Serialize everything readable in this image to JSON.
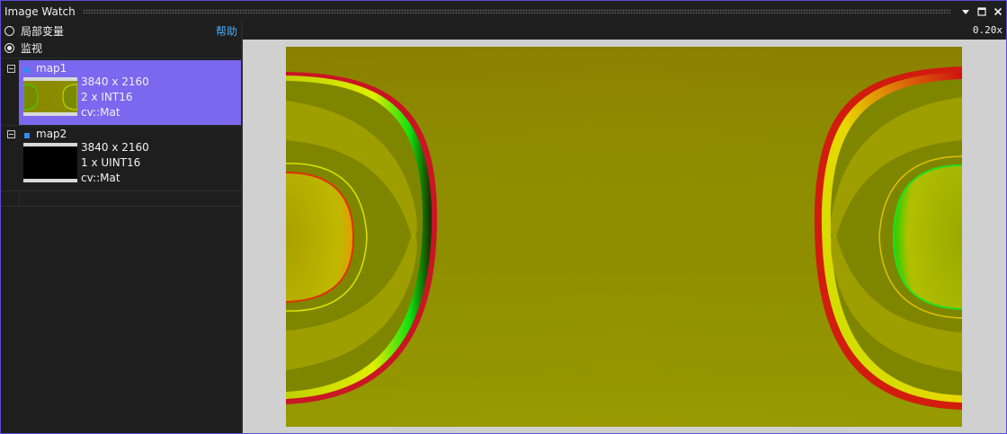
{
  "window": {
    "title": "Image Watch",
    "buttons": [
      "dropdown-icon",
      "maximize-icon",
      "close-icon"
    ]
  },
  "sidebar": {
    "mode_options": [
      {
        "label": "局部变量",
        "selected": false
      },
      {
        "label": "监视",
        "selected": true
      }
    ],
    "help_label": "帮助",
    "items": [
      {
        "name": "map1",
        "size": "3840 x 2160",
        "channels": "2 x INT16",
        "type": "cv::Mat",
        "selected": true
      },
      {
        "name": "map2",
        "size": "3840 x 2160",
        "channels": "1 x UINT16",
        "type": "cv::Mat",
        "selected": false
      }
    ]
  },
  "viewer": {
    "zoom": "0.20x",
    "image_of": "map1"
  },
  "colors": {
    "selection": "#7b68ee",
    "accent_link": "#4ea8f0",
    "item_marker": "#2f8cf4",
    "viewer_bg": "#d0d0d0",
    "panel_bg": "#1e1e1e"
  }
}
